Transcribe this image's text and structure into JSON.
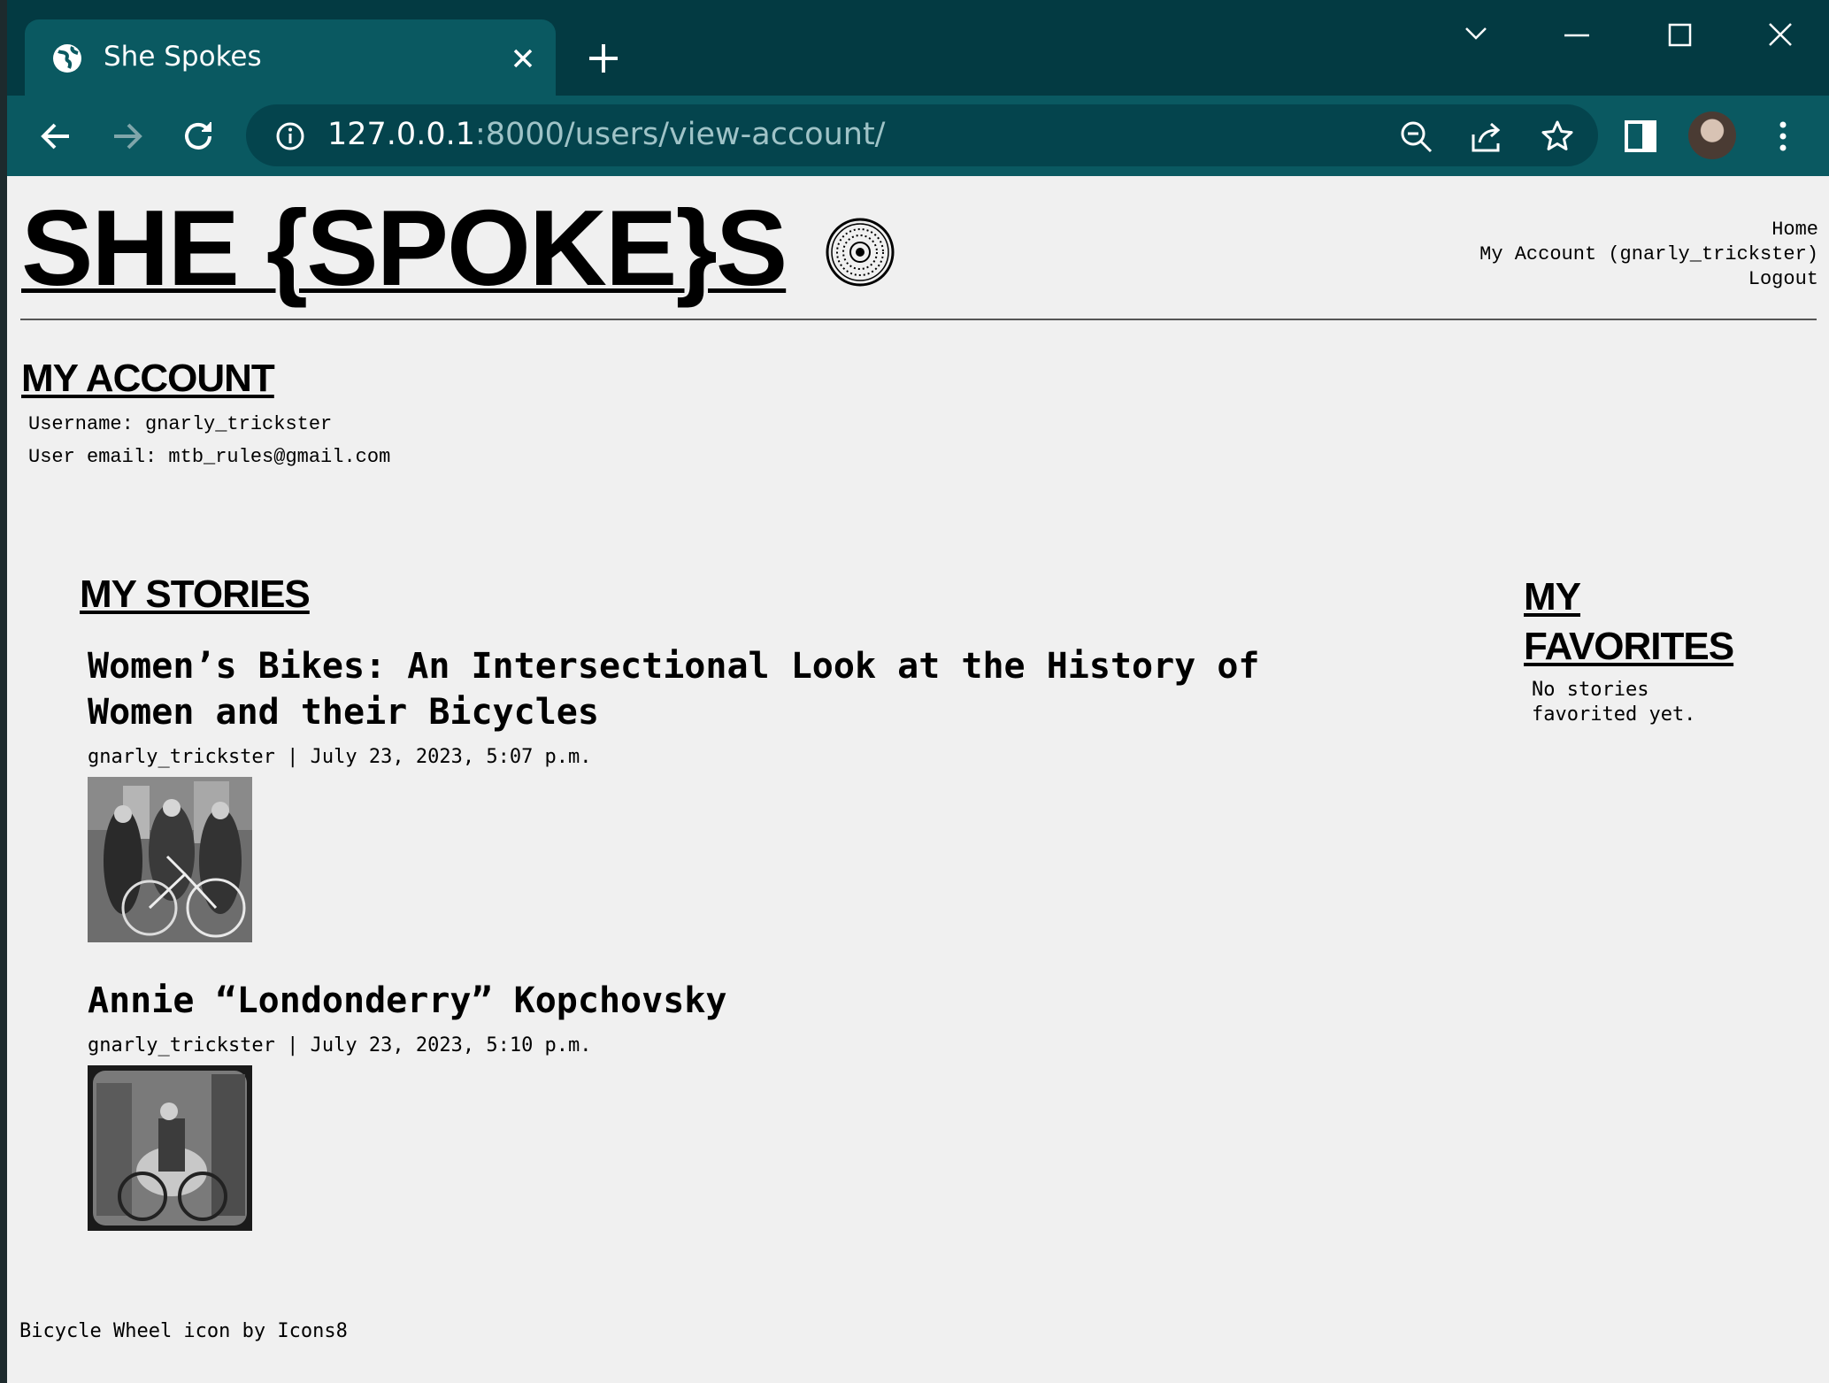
{
  "browser": {
    "tab_title": "She Spokes",
    "url_host": "127.0.0.1",
    "url_path": ":8000/users/view-account/"
  },
  "site": {
    "logo": "SHE {SPOKE}S ",
    "nav": [
      "Home",
      "My Account (gnarly_trickster)",
      "Logout"
    ]
  },
  "account": {
    "heading": "MY ACCOUNT",
    "username_line": "Username: gnarly_trickster",
    "email_line": "User email: mtb_rules@gmail.com"
  },
  "stories": {
    "heading": "MY STORIES",
    "items": [
      {
        "title": "Women’s Bikes: An Intersectional Look at the History of Women and their Bicycles",
        "meta": "gnarly_trickster | July 23, 2023, 5:07 p.m."
      },
      {
        "title": "Annie “Londonderry” Kopchovsky",
        "meta": "gnarly_trickster | July 23, 2023, 5:10 p.m."
      }
    ]
  },
  "favorites": {
    "heading": "MY FAVORITES",
    "empty_text": "No stories favorited yet."
  },
  "footer": {
    "text": "Bicycle Wheel icon by Icons8"
  },
  "colors": {
    "chrome": "#033a42",
    "tab": "#0a5961",
    "page_bg": "#f0f0f0"
  }
}
